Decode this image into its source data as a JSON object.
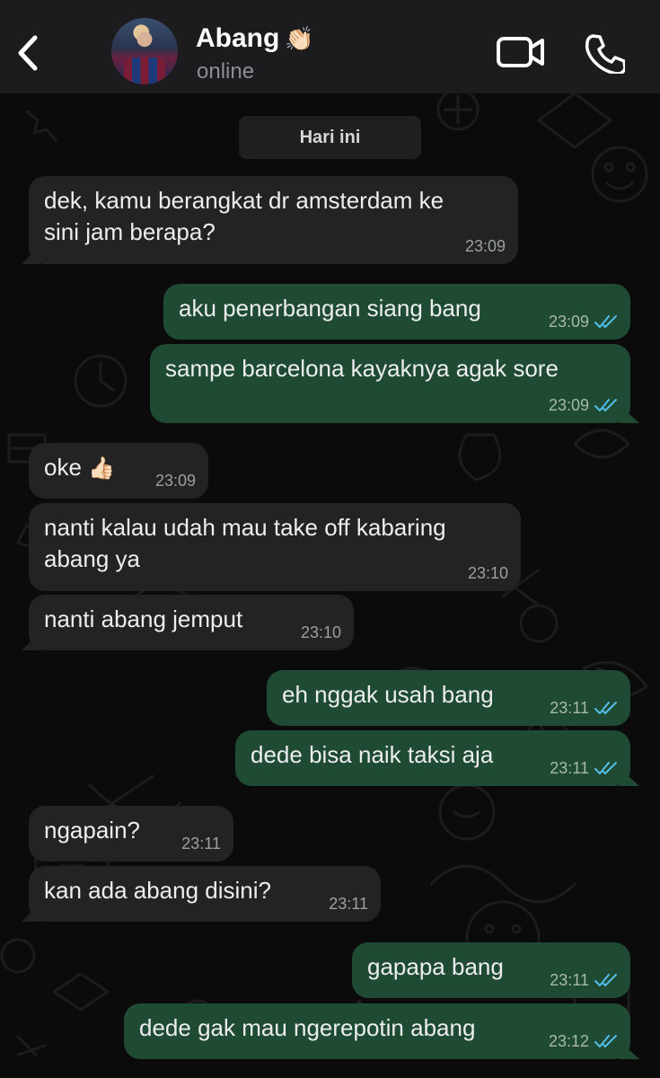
{
  "header": {
    "contact_name": "Abang",
    "contact_name_emoji": "👏🏻",
    "status": "online"
  },
  "date_separator": "Hari ini",
  "messages": [
    {
      "direction": "incoming",
      "text": [
        "dek, kamu berangkat dr amsterdam ke",
        "sini jam berapa?"
      ],
      "time": "23:09"
    },
    {
      "direction": "outgoing",
      "text": [
        "aku penerbangan siang bang"
      ],
      "time": "23:09",
      "read": true
    },
    {
      "direction": "outgoing",
      "text": [
        "sampe barcelona kayaknya agak sore"
      ],
      "time": "23:09",
      "read": true
    },
    {
      "direction": "incoming",
      "text": [
        "oke"
      ],
      "emoji": "👍🏻",
      "time": "23:09"
    },
    {
      "direction": "incoming",
      "text": [
        "nanti kalau udah mau take off kabaring",
        "abang ya"
      ],
      "time": "23:10"
    },
    {
      "direction": "incoming",
      "text": [
        "nanti abang jemput"
      ],
      "time": "23:10"
    },
    {
      "direction": "outgoing",
      "text": [
        "eh nggak usah bang"
      ],
      "time": "23:11",
      "read": true
    },
    {
      "direction": "outgoing",
      "text": [
        "dede bisa naik taksi aja"
      ],
      "time": "23:11",
      "read": true
    },
    {
      "direction": "incoming",
      "text": [
        "ngapain?"
      ],
      "time": "23:11"
    },
    {
      "direction": "incoming",
      "text": [
        "kan ada abang disini?"
      ],
      "time": "23:11"
    },
    {
      "direction": "outgoing",
      "text": [
        "gapapa bang"
      ],
      "time": "23:11",
      "read": true
    },
    {
      "direction": "outgoing",
      "text": [
        "dede gak mau ngerepotin abang"
      ],
      "time": "23:12",
      "read": true
    }
  ],
  "icons": {
    "back": "chevron-left-icon",
    "video": "video-camera-icon",
    "call": "phone-icon",
    "read_receipt": "double-check-icon"
  },
  "colors": {
    "header_bg": "#1c1c1e",
    "chat_bg": "#0b0b0b",
    "incoming_bubble": "#232323",
    "outgoing_bubble": "#1f4a33",
    "read_tick": "#53bdeb",
    "timestamp": "#9aa19d"
  }
}
